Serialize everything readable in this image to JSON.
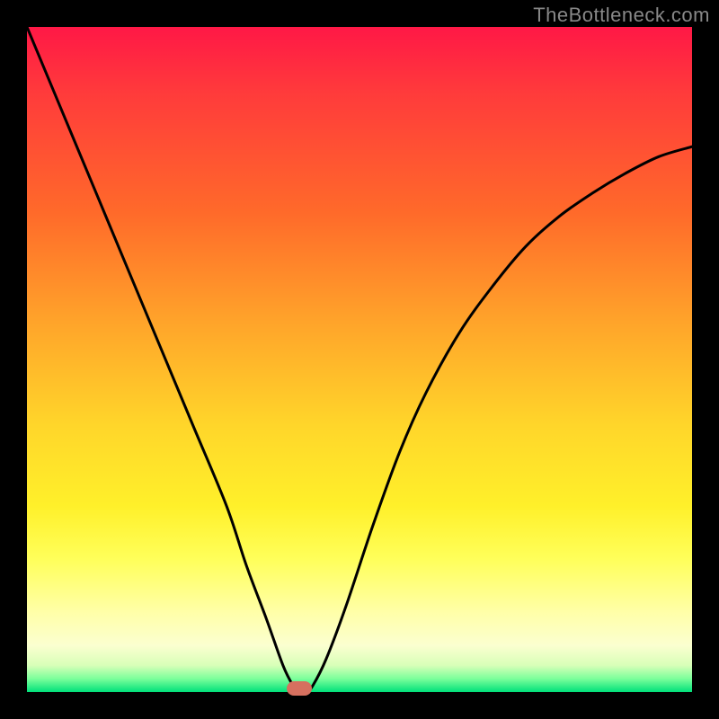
{
  "watermark": "TheBottleneck.com",
  "chart_data": {
    "type": "line",
    "title": "",
    "xlabel": "",
    "ylabel": "",
    "xlim": [
      0,
      100
    ],
    "ylim": [
      0,
      100
    ],
    "series": [
      {
        "name": "bottleneck-curve",
        "x": [
          0,
          5,
          10,
          15,
          20,
          25,
          30,
          33,
          36,
          38.5,
          40,
          41,
          42,
          43,
          45,
          48,
          52,
          56,
          60,
          65,
          70,
          75,
          80,
          85,
          90,
          95,
          100
        ],
        "y": [
          100,
          88,
          76,
          64,
          52,
          40,
          28,
          19,
          11,
          4,
          1,
          0,
          0,
          1,
          5,
          13,
          25,
          36,
          45,
          54,
          61,
          67,
          71.5,
          75,
          78,
          80.5,
          82
        ]
      }
    ],
    "annotations": [
      {
        "name": "optimal-point",
        "x": 41,
        "y": 0
      }
    ],
    "background_gradient": {
      "top": "#ff1846",
      "mid": "#fff02a",
      "bottom": "#00e07a"
    }
  }
}
